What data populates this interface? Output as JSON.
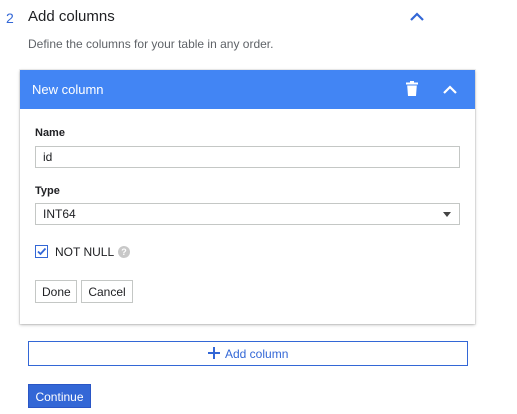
{
  "step": {
    "number": "2",
    "title": "Add columns",
    "description": "Define the columns for your table in any order."
  },
  "column_card": {
    "header_title": "New column",
    "name_label": "Name",
    "name_value": "id",
    "type_label": "Type",
    "type_value": "INT64",
    "not_null_label": "NOT NULL",
    "not_null_checked": true,
    "help_icon_text": "?",
    "done_label": "Done",
    "cancel_label": "Cancel"
  },
  "add_column_label": "Add column",
  "continue_label": "Continue",
  "colors": {
    "accent": "#3367d6",
    "header_bg": "#4285f4"
  },
  "icons": {
    "step_collapse": "chevron-up-icon",
    "delete": "trash-icon",
    "card_collapse": "chevron-up-icon",
    "checkbox": "checkmark-icon",
    "help": "help-icon",
    "add": "plus-icon"
  }
}
